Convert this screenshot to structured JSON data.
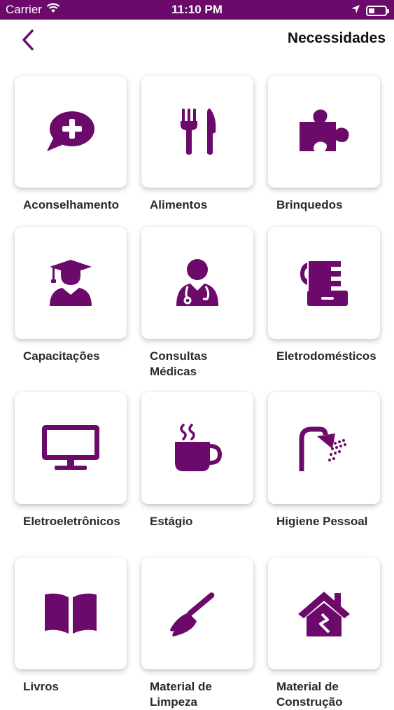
{
  "status_bar": {
    "carrier": "Carrier",
    "time": "11:10 PM",
    "battery_level": 0.35
  },
  "nav": {
    "title": "Necessidades",
    "back_icon": "chevron-left-icon"
  },
  "colors": {
    "brand": "#6b0a6b",
    "icon": "#6b0a6b",
    "label": "#2a2a2a"
  },
  "categories": [
    {
      "label": "Aconselhamento",
      "icon": "chat-plus-icon"
    },
    {
      "label": "Alimentos",
      "icon": "fork-knife-icon"
    },
    {
      "label": "Brinquedos",
      "icon": "puzzle-icon"
    },
    {
      "label": "Capacitações",
      "icon": "graduate-icon"
    },
    {
      "label": "Consultas Médicas",
      "icon": "doctor-icon"
    },
    {
      "label": "Eletrodomésticos",
      "icon": "appliance-icon"
    },
    {
      "label": "Eletroeletrônicos",
      "icon": "monitor-icon"
    },
    {
      "label": "Estágio",
      "icon": "coffee-cup-icon"
    },
    {
      "label": "Higiene Pessoal",
      "icon": "shower-icon"
    },
    {
      "label": "Livros",
      "icon": "book-icon"
    },
    {
      "label": "Material de Limpeza",
      "icon": "broom-icon"
    },
    {
      "label": "Material de Construção",
      "icon": "house-icon"
    }
  ]
}
